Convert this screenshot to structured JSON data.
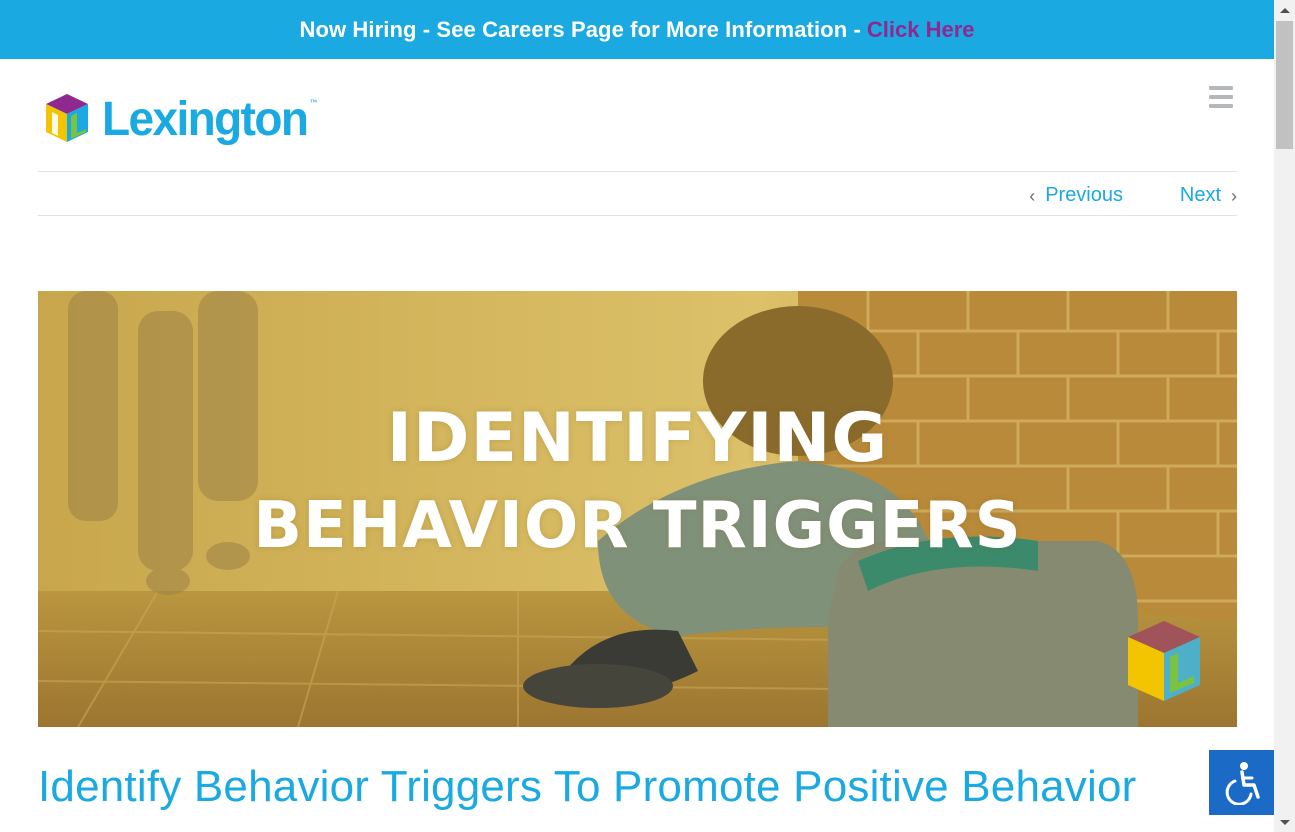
{
  "banner": {
    "text": "Now Hiring - See Careers Page for More Information -",
    "link_text": "Click Here",
    "background_color": "#1ba9e1",
    "link_color": "#8e2a8f"
  },
  "header": {
    "logo_text": "Lexington",
    "logo_tm": "™",
    "menu_icon": "hamburger-menu-icon"
  },
  "post_nav": {
    "previous_label": "Previous",
    "next_label": "Next",
    "previous_icon": "chevron-left-icon",
    "next_icon": "chevron-right-icon"
  },
  "featured_image": {
    "line1": "IDENTIFYING",
    "line2": "BEHAVIOR TRIGGERS"
  },
  "post": {
    "title": "Identify Behavior Triggers To Promote Positive Behavior"
  },
  "accessibility": {
    "icon": "wheelchair-icon",
    "background_color": "#1a6ac6"
  },
  "colors": {
    "accent": "#1ba9e1"
  }
}
